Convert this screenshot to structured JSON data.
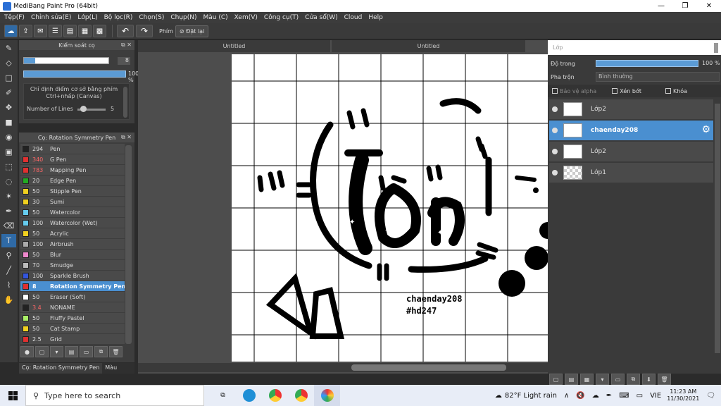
{
  "window": {
    "title": "MediBang Paint Pro (64bit)",
    "minimize": "—",
    "maximize": "❐",
    "close": "✕"
  },
  "menu": [
    "Tệp(F)",
    "Chỉnh sửa(E)",
    "Lớp(L)",
    "Bộ lọc(R)",
    "Chọn(S)",
    "Chụp(N)",
    "Màu (C)",
    "Xem(V)",
    "Công cụ(T)",
    "Cửa sổ(W)",
    "Cloud",
    "Help"
  ],
  "toolbar": {
    "phim_label": "Phím",
    "reset_label": "Đặt lại"
  },
  "brush_control": {
    "title": "Kiểm soát cọ",
    "size": "8",
    "opacity": "100 %",
    "hint": "Chỉ định điểm cơ sở bằng phím Ctrl+nhấp (Canvas)",
    "lines_label": "Number of Lines",
    "lines_value": "5"
  },
  "brush_list": {
    "title": "Cọ: Rotation Symmetry Pen",
    "items": [
      {
        "size": "294",
        "name": "Pen",
        "color": "#222222",
        "red": false
      },
      {
        "size": "340",
        "name": "G Pen",
        "color": "#e03030",
        "red": true
      },
      {
        "size": "783",
        "name": "Mapping Pen",
        "color": "#e03030",
        "red": true
      },
      {
        "size": "20",
        "name": "Edge Pen",
        "color": "#22aa22",
        "red": false
      },
      {
        "size": "50",
        "name": "Stipple Pen",
        "color": "#f0d020",
        "red": false
      },
      {
        "size": "30",
        "name": "Sumi",
        "color": "#f0d020",
        "red": false
      },
      {
        "size": "50",
        "name": "Watercolor",
        "color": "#66ccee",
        "red": false
      },
      {
        "size": "100",
        "name": "Watercolor (Wet)",
        "color": "#66ccee",
        "red": false
      },
      {
        "size": "50",
        "name": "Acrylic",
        "color": "#f0d020",
        "red": false
      },
      {
        "size": "100",
        "name": "Airbrush",
        "color": "#aaaaaa",
        "red": false
      },
      {
        "size": "50",
        "name": "Blur",
        "color": "#ee88cc",
        "red": false
      },
      {
        "size": "70",
        "name": "Smudge",
        "color": "#bbbbbb",
        "red": false
      },
      {
        "size": "100",
        "name": "Sparkle Brush",
        "color": "#3355dd",
        "red": false
      },
      {
        "size": "8",
        "name": "Rotation Symmetry Pen",
        "color": "#e03030",
        "red": false
      },
      {
        "size": "50",
        "name": "Eraser (Soft)",
        "color": "#ffffff",
        "red": false
      },
      {
        "size": "3.4",
        "name": "NONAME",
        "color": "#222222",
        "red": true
      },
      {
        "size": "50",
        "name": "Fluffy Pastel",
        "color": "#aaee66",
        "red": false
      },
      {
        "size": "50",
        "name": "Cat Stamp",
        "color": "#f0d020",
        "red": false
      },
      {
        "size": "2.5",
        "name": "Grid",
        "color": "#e03030",
        "red": false
      }
    ],
    "tab_brush": "Cọ: Rotation Symmetry Pen",
    "tab_color": "Màu"
  },
  "documents": {
    "tab1": "Untitled",
    "tab2": "Untitled"
  },
  "artwork": {
    "title_text": "Tôi",
    "signature": "chaenday208",
    "hashtag": "#hd247"
  },
  "layers": {
    "title": "Lớp",
    "opacity_label": "Độ trong",
    "opacity_value": "100 %",
    "blend_label": "Pha trộn",
    "blend_value": "Bình thường",
    "protect_alpha": "Bảo vệ alpha",
    "clipping": "Xén bớt",
    "lock": "Khóa",
    "items": [
      {
        "name": "Lớp2",
        "selected": false,
        "thumb": "art"
      },
      {
        "name": "chaenday208",
        "selected": true,
        "thumb": "text"
      },
      {
        "name": "Lớp2",
        "selected": false,
        "thumb": "art"
      },
      {
        "name": "Lớp1",
        "selected": false,
        "thumb": "empty"
      }
    ]
  },
  "taskbar": {
    "search_placeholder": "Type here to search",
    "weather": "82°F  Light rain",
    "lang": "VIE",
    "time": "11:23 AM",
    "date": "11/30/2021"
  }
}
